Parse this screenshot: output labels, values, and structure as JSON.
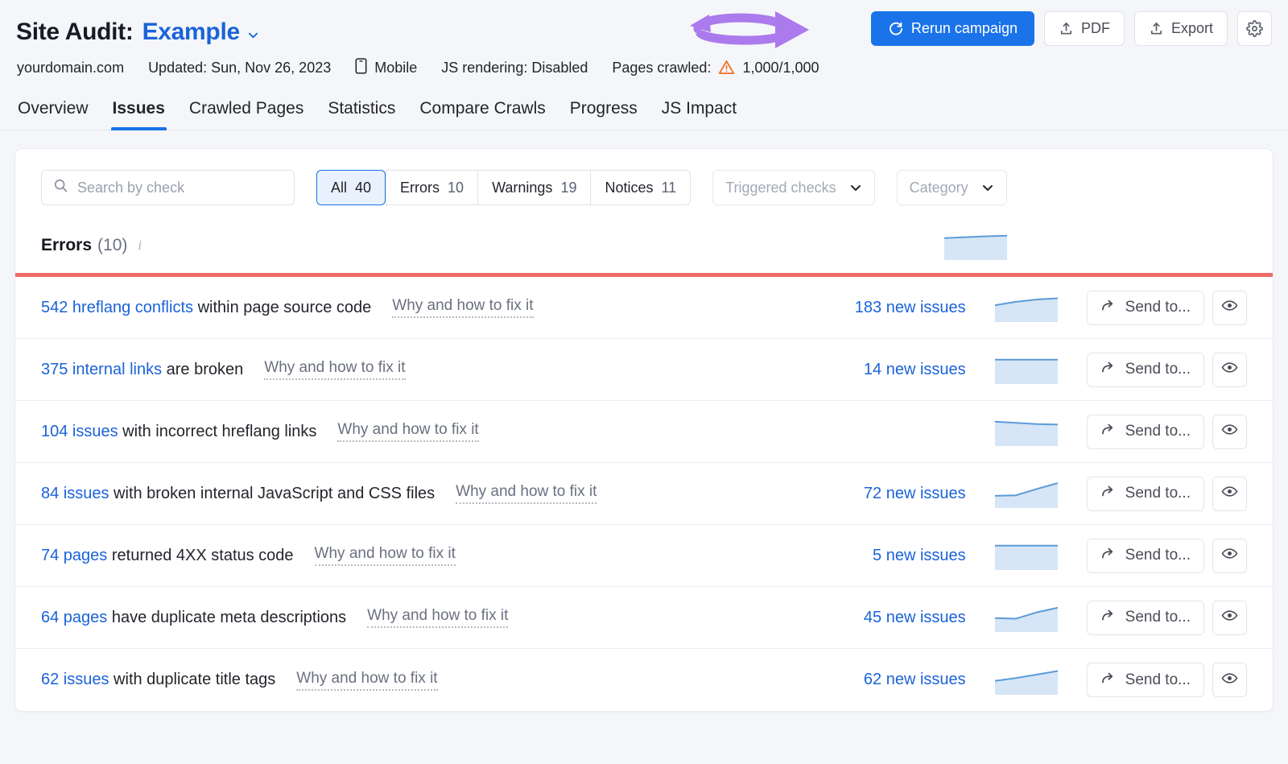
{
  "header": {
    "title_label": "Site Audit:",
    "campaign_name": "Example",
    "campaign_chevron_icon": "chevron-down-icon",
    "actions": {
      "rerun_label": "Rerun campaign",
      "rerun_icon": "refresh-icon",
      "pdf_label": "PDF",
      "pdf_icon": "upload-icon",
      "export_label": "Export",
      "export_icon": "upload-icon",
      "settings_icon": "gear-icon"
    },
    "meta": {
      "domain": "yourdomain.com",
      "updated": "Updated: Sun, Nov 26, 2023",
      "device_icon": "mobile-icon",
      "device": "Mobile",
      "js_rendering": "JS rendering: Disabled",
      "pages_crawled_label": "Pages crawled:",
      "pages_crawled_warning_icon": "warning-triangle-icon",
      "pages_crawled_value": "1,000/1,000"
    },
    "annotation": {
      "type": "double-headed-curved-arrow",
      "color": "#ab7aec",
      "points_to": "Rerun campaign"
    }
  },
  "tabs": [
    {
      "label": "Overview",
      "active": false
    },
    {
      "label": "Issues",
      "active": true
    },
    {
      "label": "Crawled Pages",
      "active": false
    },
    {
      "label": "Statistics",
      "active": false
    },
    {
      "label": "Compare Crawls",
      "active": false
    },
    {
      "label": "Progress",
      "active": false
    },
    {
      "label": "JS Impact",
      "active": false
    }
  ],
  "filters": {
    "search_placeholder": "Search by check",
    "search_value": "",
    "search_icon": "search-icon",
    "segments": [
      {
        "label": "All",
        "count": "40",
        "active": true
      },
      {
        "label": "Errors",
        "count": "10",
        "active": false
      },
      {
        "label": "Warnings",
        "count": "19",
        "active": false
      },
      {
        "label": "Notices",
        "count": "11",
        "active": false
      }
    ],
    "triggered_checks": {
      "label": "Triggered checks",
      "icon": "chevron-down-icon"
    },
    "category": {
      "label": "Category",
      "icon": "chevron-down-icon"
    }
  },
  "section": {
    "title": "Errors",
    "count": "(10)",
    "info_icon": "info-icon",
    "severity_color": "#ee6a64"
  },
  "row_actions": {
    "send_to_label": "Send to...",
    "send_to_icon": "share-arrow-icon",
    "view_icon": "eye-icon"
  },
  "issues": [
    {
      "count_text": "542 hreflang conflicts",
      "rest_text": " within page source code",
      "fix_link": "Why and how to fix it",
      "new_issues": "183 new issues"
    },
    {
      "count_text": "375 internal links",
      "rest_text": " are broken",
      "fix_link": "Why and how to fix it",
      "new_issues": "14 new issues"
    },
    {
      "count_text": "104 issues",
      "rest_text": " with incorrect hreflang links",
      "fix_link": "Why and how to fix it",
      "new_issues": ""
    },
    {
      "count_text": "84 issues",
      "rest_text": " with broken internal JavaScript and CSS files",
      "fix_link": "Why and how to fix it",
      "new_issues": "72 new issues"
    },
    {
      "count_text": "74 pages",
      "rest_text": " returned 4XX status code",
      "fix_link": "Why and how to fix it",
      "new_issues": "5 new issues"
    },
    {
      "count_text": "64 pages",
      "rest_text": " have duplicate meta descriptions",
      "fix_link": "Why and how to fix it",
      "new_issues": "45 new issues"
    },
    {
      "count_text": "62 issues",
      "rest_text": " with duplicate title tags",
      "fix_link": "Why and how to fix it",
      "new_issues": "62 new issues"
    }
  ],
  "chart_data": {
    "type": "area",
    "title": "Issue trend sparklines",
    "xlabel": "",
    "ylabel": "",
    "grid": false,
    "legend": "none",
    "line_color": "#5b9bd8",
    "fill_color": "#d6e6f7",
    "series": [
      {
        "name": "section-header-trend",
        "values": [
          0.8,
          0.83,
          0.86,
          0.88
        ]
      },
      {
        "name": "542 hreflang conflicts",
        "values": [
          0.62,
          0.74,
          0.82,
          0.86
        ]
      },
      {
        "name": "375 internal links are broken",
        "values": [
          0.88,
          0.88,
          0.88,
          0.88
        ]
      },
      {
        "name": "104 issues with incorrect hreflang links",
        "values": [
          0.88,
          0.84,
          0.8,
          0.78
        ]
      },
      {
        "name": "84 issues broken JS and CSS files",
        "values": [
          0.46,
          0.48,
          0.7,
          0.9
        ]
      },
      {
        "name": "74 pages returned 4XX status code",
        "values": [
          0.88,
          0.88,
          0.88,
          0.88
        ]
      },
      {
        "name": "64 pages duplicate meta descriptions",
        "values": [
          0.52,
          0.5,
          0.72,
          0.88
        ]
      },
      {
        "name": "62 issues with duplicate title tags",
        "values": [
          0.52,
          0.62,
          0.74,
          0.86
        ]
      }
    ]
  }
}
